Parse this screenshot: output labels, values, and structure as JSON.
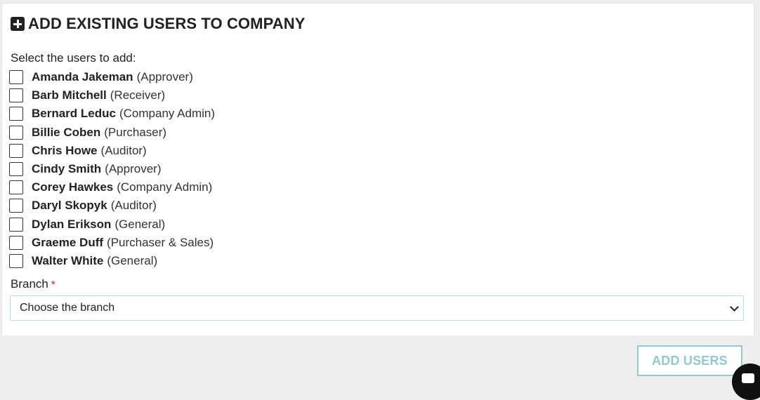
{
  "header": {
    "title": "ADD EXISTING USERS TO COMPANY"
  },
  "form": {
    "prompt": "Select the users to add:",
    "users": [
      {
        "name": "Amanda Jakeman",
        "role": "(Approver)"
      },
      {
        "name": "Barb Mitchell",
        "role": "(Receiver)"
      },
      {
        "name": "Bernard Leduc",
        "role": "(Company Admin)"
      },
      {
        "name": "Billie Coben",
        "role": "(Purchaser)"
      },
      {
        "name": "Chris Howe",
        "role": "(Auditor)"
      },
      {
        "name": "Cindy Smith",
        "role": "(Approver)"
      },
      {
        "name": "Corey Hawkes",
        "role": "(Company Admin)"
      },
      {
        "name": "Daryl Skopyk",
        "role": "(Auditor)"
      },
      {
        "name": "Dylan Erikson",
        "role": "(General)"
      },
      {
        "name": "Graeme Duff",
        "role": "(Purchaser & Sales)"
      },
      {
        "name": "Walter White",
        "role": "(General)"
      }
    ],
    "branch_label": "Branch",
    "required_marker": "*",
    "branch_select_value": "Choose the branch"
  },
  "footer": {
    "add_button_label": "ADD USERS"
  },
  "colors": {
    "accent": "#8fcad0",
    "required": "#d9241b",
    "footer_bg": "#eeeeee"
  },
  "icons": {
    "title_icon": "plus-square-icon",
    "select_icon": "chevron-down-icon",
    "chat_icon": "chat-icon"
  }
}
